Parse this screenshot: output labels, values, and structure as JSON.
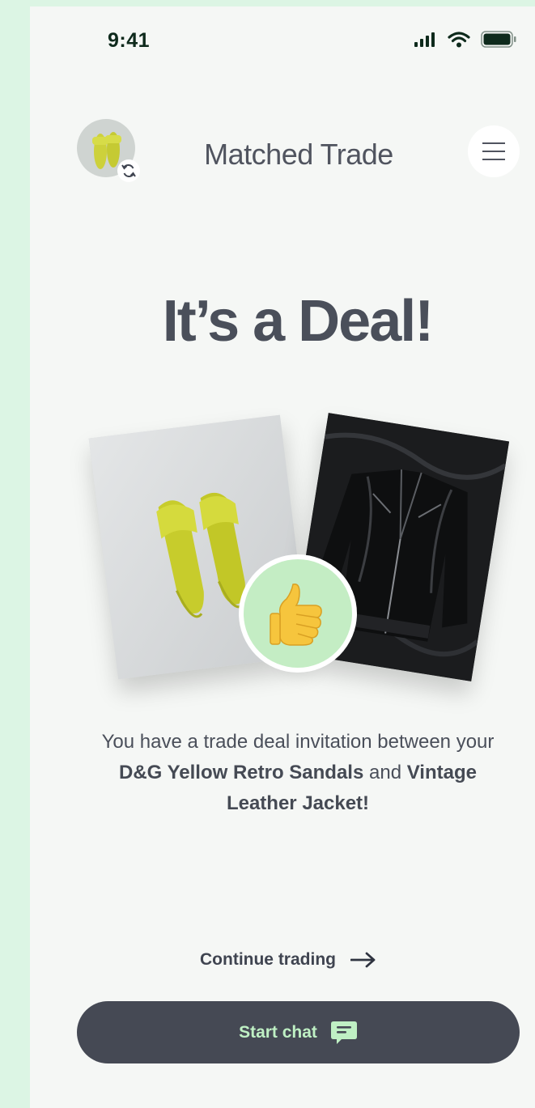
{
  "status_bar": {
    "time": "9:41"
  },
  "header": {
    "title": "Matched Trade"
  },
  "headline": "It’s a Deal!",
  "message": {
    "prefix": "You have a trade deal invitation between your",
    "item_a": "D&G Yellow Retro Sandals",
    "connector": "and",
    "item_b": "Vintage Leather Jacket!"
  },
  "actions": {
    "continue_label": "Continue trading",
    "chat_label": "Start chat"
  },
  "colors": {
    "background": "#dcf5e4",
    "screen": "#f5f7f5",
    "accent_green": "#c4edc4",
    "button_dark": "#454954",
    "button_text": "#bff0c4",
    "text_dark": "#4a4f5a"
  },
  "icons": [
    "signal-icon",
    "wifi-icon",
    "battery-icon",
    "swap-icon",
    "menu-icon",
    "thumbs-up-icon",
    "arrow-right-icon",
    "chat-bubble-icon"
  ]
}
